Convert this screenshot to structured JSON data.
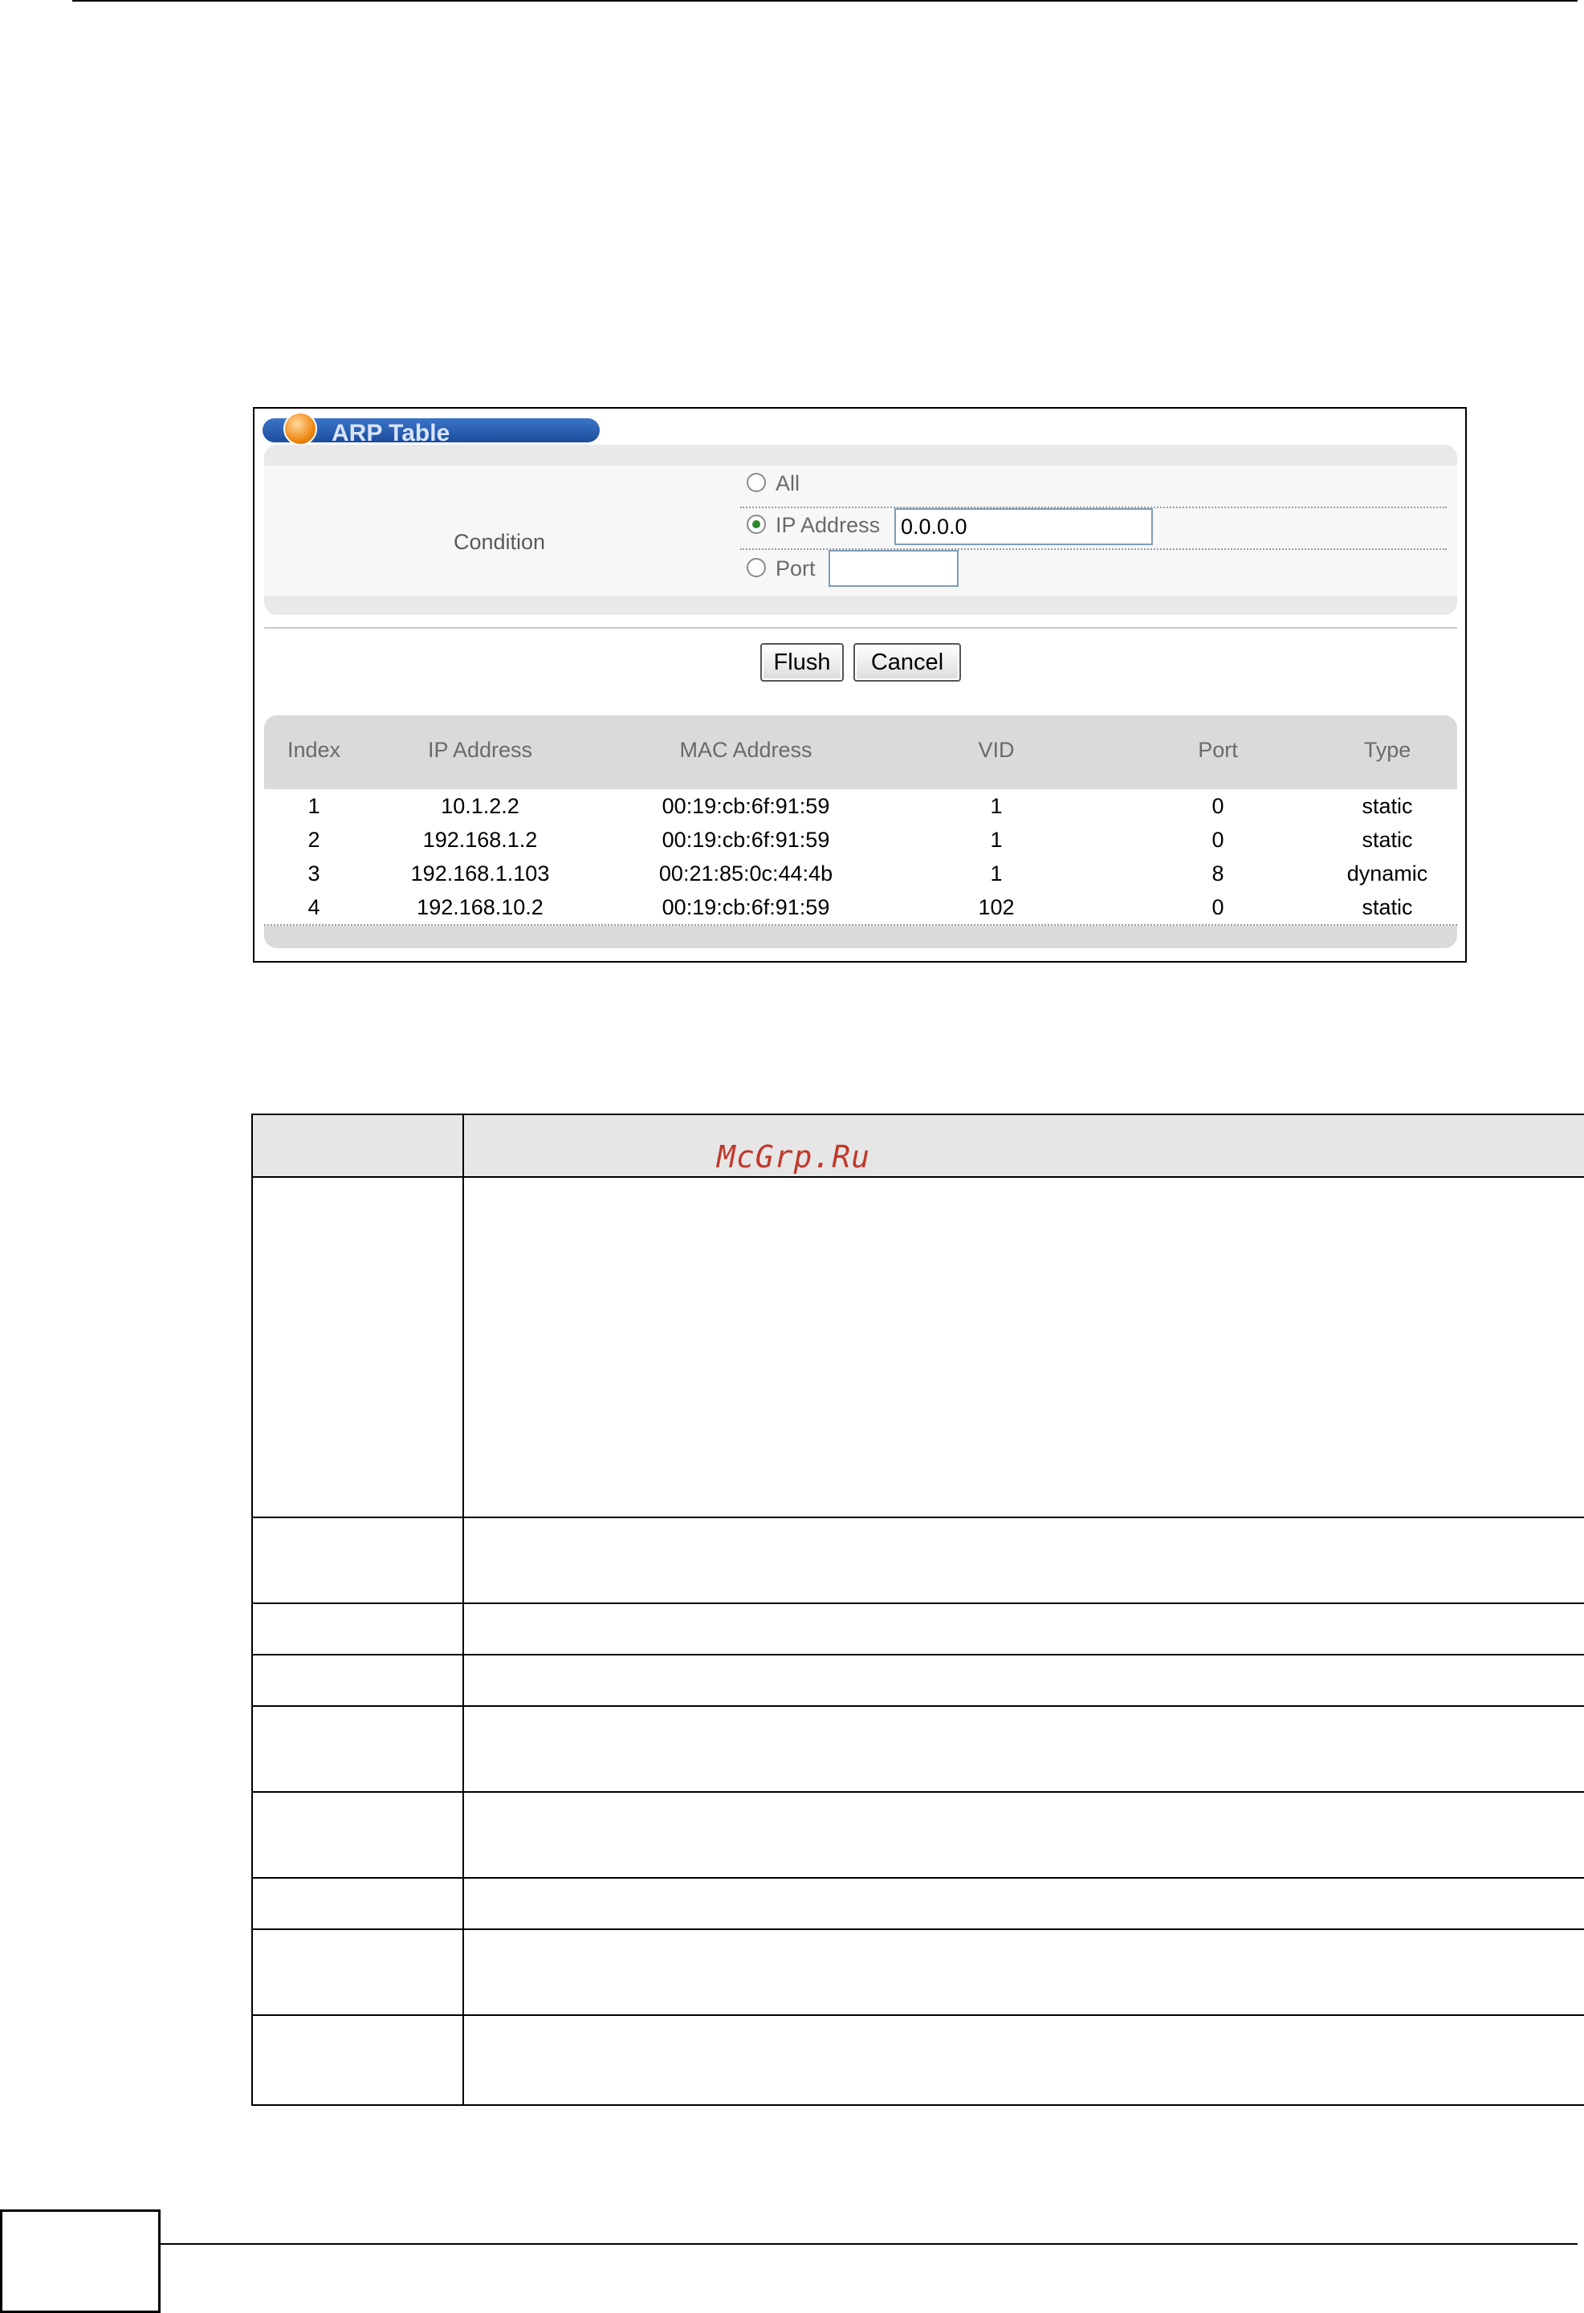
{
  "window": {
    "title": "ARP Table"
  },
  "condition": {
    "label": "Condition",
    "options": [
      {
        "label": "All",
        "selected": false
      },
      {
        "label": "IP Address",
        "selected": true,
        "value": "0.0.0.0"
      },
      {
        "label": "Port",
        "selected": false,
        "value": ""
      }
    ]
  },
  "buttons": {
    "flush": "Flush",
    "cancel": "Cancel"
  },
  "arp_table": {
    "columns": [
      "Index",
      "IP Address",
      "MAC Address",
      "VID",
      "Port",
      "Type"
    ],
    "rows": [
      [
        "1",
        "10.1.2.2",
        "00:19:cb:6f:91:59",
        "1",
        "0",
        "static"
      ],
      [
        "2",
        "192.168.1.2",
        "00:19:cb:6f:91:59",
        "1",
        "0",
        "static"
      ],
      [
        "3",
        "192.168.1.103",
        "00:21:85:0c:44:4b",
        "1",
        "8",
        "dynamic"
      ],
      [
        "4",
        "192.168.10.2",
        "00:19:cb:6f:91:59",
        "102",
        "0",
        "static"
      ]
    ]
  },
  "watermark": "McGrp.Ru",
  "colors": {
    "title_bar": "#1d4d9c",
    "watermark": "#c0392b",
    "selected_radio": "#2a8a2a"
  }
}
